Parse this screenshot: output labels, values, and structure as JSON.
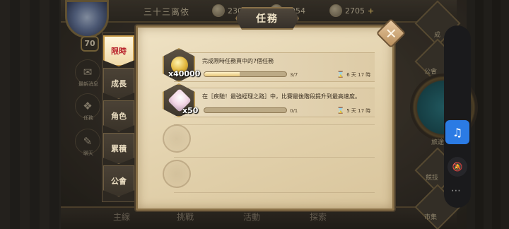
{
  "topbar": {
    "player_name": "三十三离依",
    "resource_1": "230",
    "resource_2": "2954",
    "resource_3": "2705",
    "plus": "+"
  },
  "player": {
    "level": "70"
  },
  "sidebar": {
    "items": [
      {
        "label": "最新消息",
        "icon": "news-icon"
      },
      {
        "label": "任務",
        "icon": "quest-icon"
      },
      {
        "label": "聊天",
        "icon": "chat-icon"
      }
    ]
  },
  "bottom_nav": {
    "tabs": [
      "主線",
      "挑戰",
      "活動",
      "探索"
    ]
  },
  "right_nav": {
    "items": [
      "成",
      "公會",
      "旅途",
      "競技",
      "市集"
    ]
  },
  "dialog": {
    "title": "任務",
    "close": "✕",
    "tabs": [
      {
        "label": "限時",
        "active": true
      },
      {
        "label": "成長",
        "active": false
      },
      {
        "label": "角色",
        "active": false
      },
      {
        "label": "累積",
        "active": false
      },
      {
        "label": "公會",
        "active": false
      }
    ],
    "tasks": [
      {
        "title": "完成限時任務頁中的7個任務",
        "reward_qty": "x40000",
        "reward_icon": "gold-coin-icon",
        "progress_text": "3/7",
        "progress_fraction": 0.43,
        "time_left": "6 天 17 時"
      },
      {
        "title": "在［疾馳！最強經理之路］中，比賽最後階段提升到最高速度。",
        "reward_qty": "x50",
        "reward_icon": "crystal-icon",
        "progress_text": "0/1",
        "progress_fraction": 0.0,
        "time_left": "5 天 17 時"
      }
    ]
  },
  "overlay": {
    "music_icon": "♫",
    "mute_icon": "🔕",
    "more": "⋯"
  },
  "colors": {
    "active_tab_text": "#b8222a",
    "parchment": "#e9dcc0",
    "overlay_accent": "#2b7be4"
  }
}
